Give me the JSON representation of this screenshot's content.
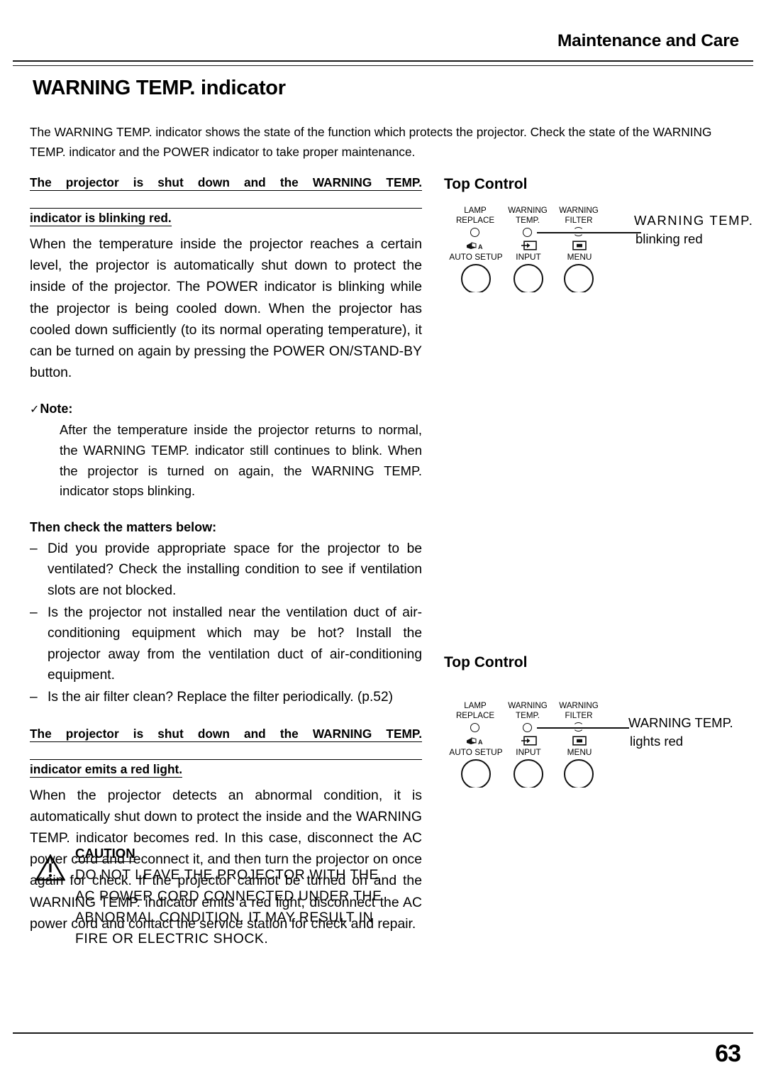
{
  "header": {
    "section_title": "Maintenance and Care"
  },
  "page_title": "WARNING TEMP. indicator",
  "intro": "The WARNING TEMP. indicator shows the state of the function which protects the projector. Check the state of the WARNING TEMP. indicator and the POWER indicator to take proper maintenance.",
  "section_blinking": {
    "heading_line1": "The projector is shut down and the WARNING TEMP.",
    "heading_line2": "indicator is blinking red.",
    "body": "When the temperature inside the projector reaches a certain level, the projector is automatically shut down to protect the inside of the projector. The POWER indicator is blinking while the projector is being cooled down.  When the projector has cooled down sufficiently (to its normal operating temperature), it can be turned on again by pressing the POWER ON/STAND-BY button."
  },
  "note": {
    "check_mark": "✓",
    "label": "Note:",
    "body": "After the temperature inside the projector returns to normal, the WARNING TEMP. indicator still continues to blink.  When the projector is turned on again, the WARNING TEMP. indicator stops blinking."
  },
  "matters": {
    "heading": "Then check the matters below:",
    "dash": "–",
    "items": [
      "Did you provide appropriate space for the projector to be ventilated?  Check the installing condition to see if ventilation slots are not blocked.",
      "Is the projector not installed near the ventilation duct of air-conditioning equipment which may be hot? Install the projector away from the ventilation duct of air-conditioning equipment.",
      "Is the air filter clean? Replace the filter periodically. (p.52)"
    ]
  },
  "section_red_light": {
    "heading_line1": "The projector is shut down and the WARNING TEMP.",
    "heading_line2": "indicator emits a red light.",
    "body": "When the projector detects an abnormal condition, it is automatically shut down to protect the inside and the WARNING TEMP. indicator becomes red.  In this case, disconnect the AC power cord and reconnect it, and then turn the projector on once again for check. If the projector cannot be turned on and the WARNING TEMP. indicator emits a red light, disconnect the AC power cord and contact the service station for check and repair."
  },
  "caution": {
    "heading": "CAUTION",
    "line1": "DO NOT LEAVE THE PROJECTOR WITH THE",
    "line2": "AC POWER CORD CONNECTED UNDER THE",
    "line3": "ABNORMAL CONDITION.  IT MAY RESULT IN",
    "line4": "FIRE OR ELECTRIC SHOCK."
  },
  "diagram_top": {
    "title": "Top Control",
    "indicators": [
      {
        "line1": "LAMP",
        "line2": "REPLACE"
      },
      {
        "line1": "WARNING",
        "line2": "TEMP."
      },
      {
        "line1": "WARNING",
        "line2": "FILTER"
      }
    ],
    "buttons": [
      {
        "label": "AUTO SETUP",
        "icon": "auto-setup-icon"
      },
      {
        "label": "INPUT",
        "icon": "input-icon"
      },
      {
        "label": "MENU",
        "icon": "menu-icon"
      }
    ],
    "callout_line1": "WARNING TEMP.",
    "callout_line2": "blinking red"
  },
  "diagram_bottom": {
    "title": "Top Control",
    "indicators": [
      {
        "line1": "LAMP",
        "line2": "REPLACE"
      },
      {
        "line1": "WARNING",
        "line2": "TEMP."
      },
      {
        "line1": "WARNING",
        "line2": "FILTER"
      }
    ],
    "buttons": [
      {
        "label": "AUTO SETUP",
        "icon": "auto-setup-icon"
      },
      {
        "label": "INPUT",
        "icon": "input-icon"
      },
      {
        "label": "MENU",
        "icon": "menu-icon"
      }
    ],
    "callout_line1": "WARNING TEMP.",
    "callout_line2": "lights red"
  },
  "footer": {
    "page_number": "63"
  }
}
